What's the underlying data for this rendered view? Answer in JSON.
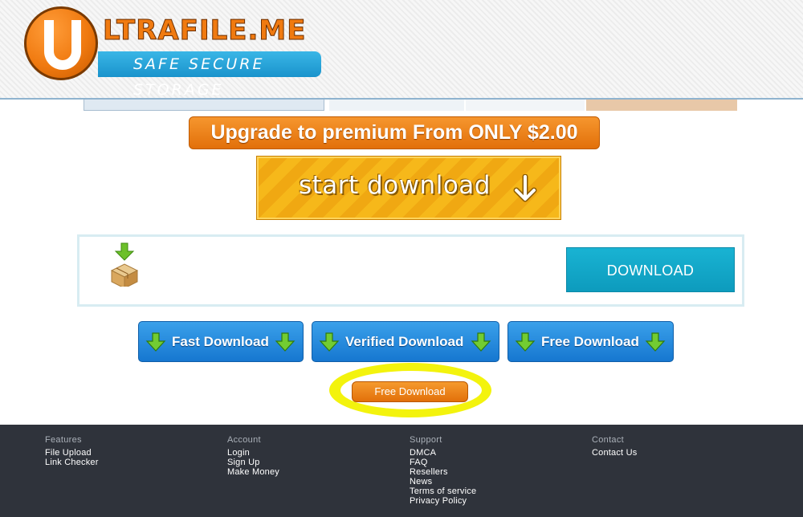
{
  "header": {
    "logo_top": "LTRAFILE.ME",
    "logo_tagline": "SAFE SECURE STORAGE"
  },
  "premium": {
    "label": "Upgrade to premium From ONLY $2.00"
  },
  "start_download": {
    "label": "start download"
  },
  "file_panel": {
    "download_label": "DOWNLOAD"
  },
  "buttons": {
    "fast": "Fast Download",
    "verified": "Verified Download",
    "free": "Free Download",
    "small_free": "Free Download"
  },
  "colors": {
    "accent_orange": "#f07a10",
    "accent_blue": "#1a93cc",
    "highlight_yellow": "#f2f200",
    "footer_bg": "#2f333b"
  },
  "footer": {
    "features": {
      "heading": "Features",
      "links": [
        "File Upload",
        "Link Checker"
      ]
    },
    "account": {
      "heading": "Account",
      "links": [
        "Login",
        "Sign Up",
        "Make Money"
      ]
    },
    "support": {
      "heading": "Support",
      "links": [
        "DMCA",
        "FAQ",
        "Resellers",
        "News",
        "Terms of service",
        "Privacy Policy"
      ]
    },
    "contact": {
      "heading": "Contact",
      "links": [
        "Contact Us"
      ]
    }
  }
}
